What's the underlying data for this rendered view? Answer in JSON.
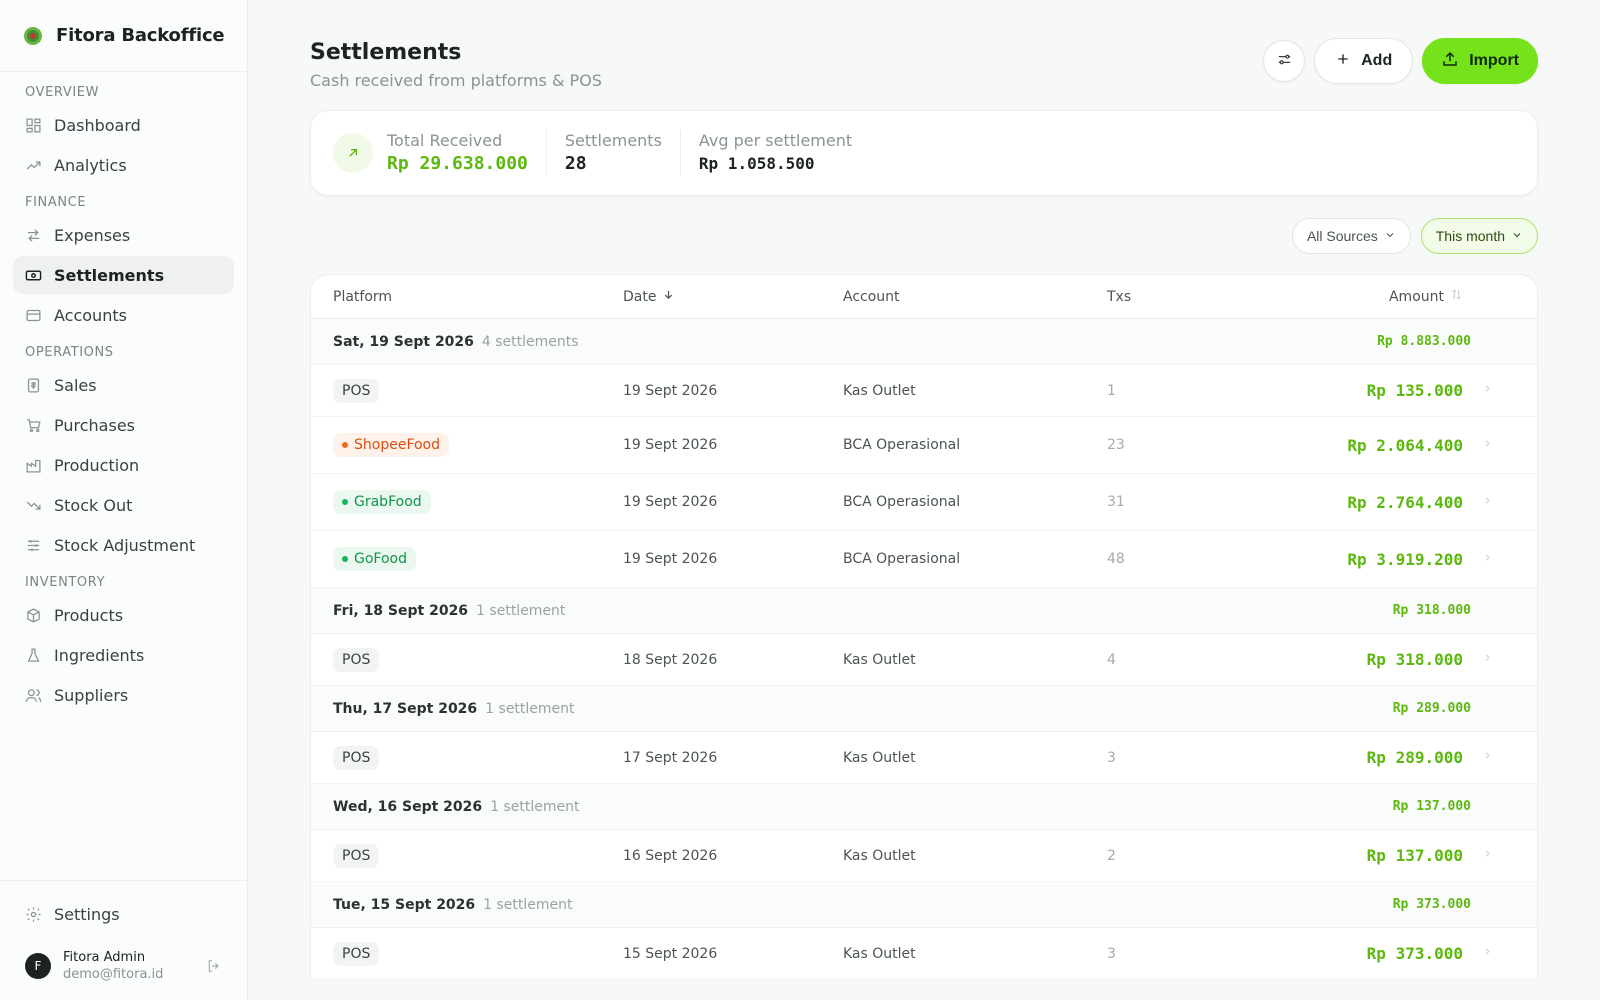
{
  "brand": {
    "name": "Fitora Backoffice"
  },
  "sidebar": {
    "sections": [
      {
        "title": "Overview",
        "items": [
          {
            "label": "Dashboard",
            "icon": "dashboard-icon"
          },
          {
            "label": "Analytics",
            "icon": "trending-up-icon"
          }
        ]
      },
      {
        "title": "Finance",
        "items": [
          {
            "label": "Expenses",
            "icon": "transfer-icon"
          },
          {
            "label": "Settlements",
            "icon": "banknote-icon",
            "active": true
          },
          {
            "label": "Accounts",
            "icon": "wallet-icon"
          }
        ]
      },
      {
        "title": "Operations",
        "items": [
          {
            "label": "Sales",
            "icon": "receipt-icon"
          },
          {
            "label": "Purchases",
            "icon": "cart-icon"
          },
          {
            "label": "Production",
            "icon": "factory-icon"
          },
          {
            "label": "Stock Out",
            "icon": "trending-down-icon"
          },
          {
            "label": "Stock Adjustment",
            "icon": "sliders-icon"
          }
        ]
      },
      {
        "title": "Inventory",
        "items": [
          {
            "label": "Products",
            "icon": "package-icon"
          },
          {
            "label": "Ingredients",
            "icon": "flask-icon"
          },
          {
            "label": "Suppliers",
            "icon": "users-icon"
          }
        ]
      }
    ],
    "settings_label": "Settings",
    "user": {
      "initial": "F",
      "name": "Fitora Admin",
      "email": "demo@fitora.id"
    }
  },
  "header": {
    "title": "Settlements",
    "subtitle": "Cash received from platforms & POS",
    "add_label": "Add",
    "import_label": "Import"
  },
  "summary": {
    "total_label": "Total Received",
    "total_value": "Rp 29.638.000",
    "count_label": "Settlements",
    "count_value": "28",
    "avg_label": "Avg per settlement",
    "avg_value": "Rp 1.058.500"
  },
  "filters": {
    "source": "All Sources",
    "period": "This month"
  },
  "table": {
    "columns": {
      "platform": "Platform",
      "date": "Date",
      "account": "Account",
      "txs": "Txs",
      "amount": "Amount"
    },
    "groups": [
      {
        "date": "Sat, 19 Sept 2026",
        "count": "4 settlements",
        "total": "Rp 8.883.000",
        "rows": [
          {
            "platform": "POS",
            "kind": "pos",
            "date": "19 Sept 2026",
            "account": "Kas Outlet",
            "txs": "1",
            "amount": "Rp 135.000"
          },
          {
            "platform": "ShopeeFood",
            "kind": "shopee",
            "date": "19 Sept 2026",
            "account": "BCA Operasional",
            "txs": "23",
            "amount": "Rp 2.064.400"
          },
          {
            "platform": "GrabFood",
            "kind": "grab",
            "date": "19 Sept 2026",
            "account": "BCA Operasional",
            "txs": "31",
            "amount": "Rp 2.764.400"
          },
          {
            "platform": "GoFood",
            "kind": "gofood",
            "date": "19 Sept 2026",
            "account": "BCA Operasional",
            "txs": "48",
            "amount": "Rp 3.919.200"
          }
        ]
      },
      {
        "date": "Fri, 18 Sept 2026",
        "count": "1 settlement",
        "total": "Rp 318.000",
        "rows": [
          {
            "platform": "POS",
            "kind": "pos",
            "date": "18 Sept 2026",
            "account": "Kas Outlet",
            "txs": "4",
            "amount": "Rp 318.000"
          }
        ]
      },
      {
        "date": "Thu, 17 Sept 2026",
        "count": "1 settlement",
        "total": "Rp 289.000",
        "rows": [
          {
            "platform": "POS",
            "kind": "pos",
            "date": "17 Sept 2026",
            "account": "Kas Outlet",
            "txs": "3",
            "amount": "Rp 289.000"
          }
        ]
      },
      {
        "date": "Wed, 16 Sept 2026",
        "count": "1 settlement",
        "total": "Rp 137.000",
        "rows": [
          {
            "platform": "POS",
            "kind": "pos",
            "date": "16 Sept 2026",
            "account": "Kas Outlet",
            "txs": "2",
            "amount": "Rp 137.000"
          }
        ]
      },
      {
        "date": "Tue, 15 Sept 2026",
        "count": "1 settlement",
        "total": "Rp 373.000",
        "rows": [
          {
            "platform": "POS",
            "kind": "pos",
            "date": "15 Sept 2026",
            "account": "Kas Outlet",
            "txs": "3",
            "amount": "Rp 373.000"
          }
        ]
      }
    ]
  }
}
